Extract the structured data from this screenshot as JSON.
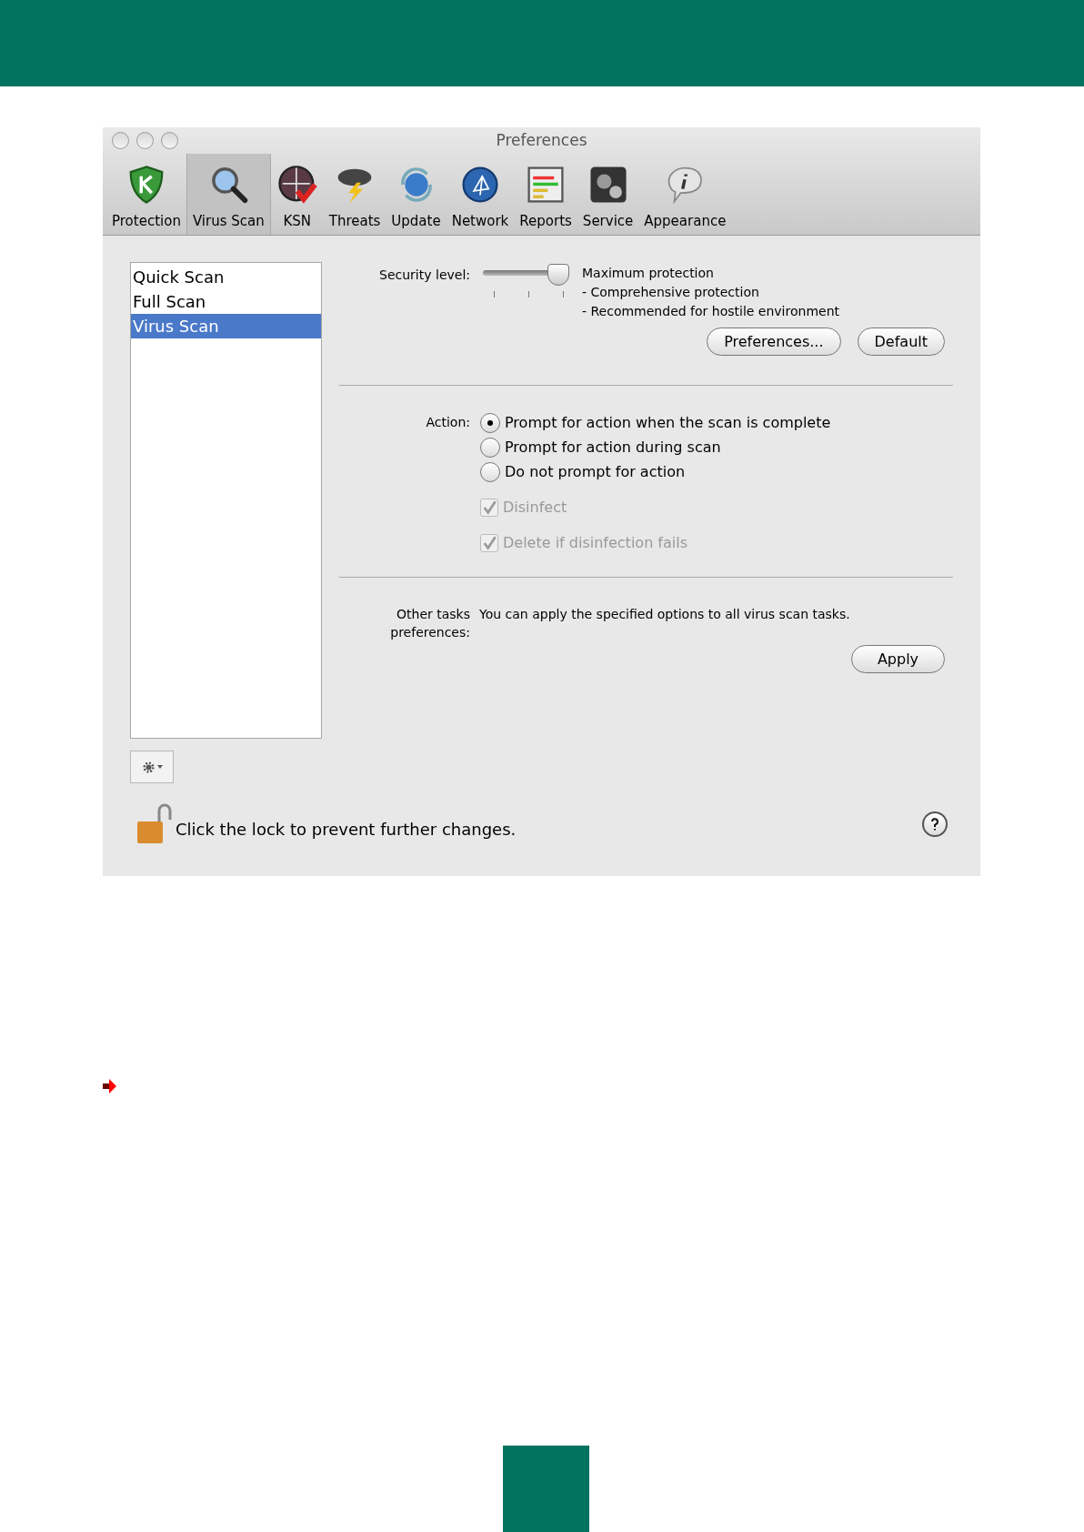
{
  "window": {
    "title": "Preferences"
  },
  "toolbar": [
    {
      "label": "Protection",
      "selected": false
    },
    {
      "label": "Virus Scan",
      "selected": true
    },
    {
      "label": "KSN",
      "selected": false
    },
    {
      "label": "Threats",
      "selected": false
    },
    {
      "label": "Update",
      "selected": false
    },
    {
      "label": "Network",
      "selected": false
    },
    {
      "label": "Reports",
      "selected": false
    },
    {
      "label": "Service",
      "selected": false
    },
    {
      "label": "Appearance",
      "selected": false
    }
  ],
  "task_list": [
    {
      "label": "Quick Scan",
      "selected": false
    },
    {
      "label": "Full Scan",
      "selected": false
    },
    {
      "label": "Virus Scan",
      "selected": true
    }
  ],
  "security": {
    "label": "Security level:",
    "level": 1,
    "description": [
      "Maximum protection",
      "- Comprehensive protection",
      "- Recommended for hostile environment"
    ],
    "buttons": [
      "Preferences...",
      "Default"
    ]
  },
  "action": {
    "label": "Action:",
    "options": [
      {
        "label": "Prompt for action when the scan is complete",
        "selected": true
      },
      {
        "label": "Prompt for action during scan",
        "selected": false
      },
      {
        "label": "Do not prompt for action",
        "selected": false
      }
    ],
    "checkboxes": [
      {
        "label": "Disinfect",
        "checked": true,
        "disabled": true
      },
      {
        "label": "Delete if disinfection fails",
        "checked": true,
        "disabled": true
      }
    ]
  },
  "other_tasks": {
    "label": "Other tasks preferences:",
    "text": "You can apply the specified options to all virus scan tasks.",
    "button": "Apply"
  },
  "lock": {
    "text": "Click the lock to prevent further changes."
  }
}
